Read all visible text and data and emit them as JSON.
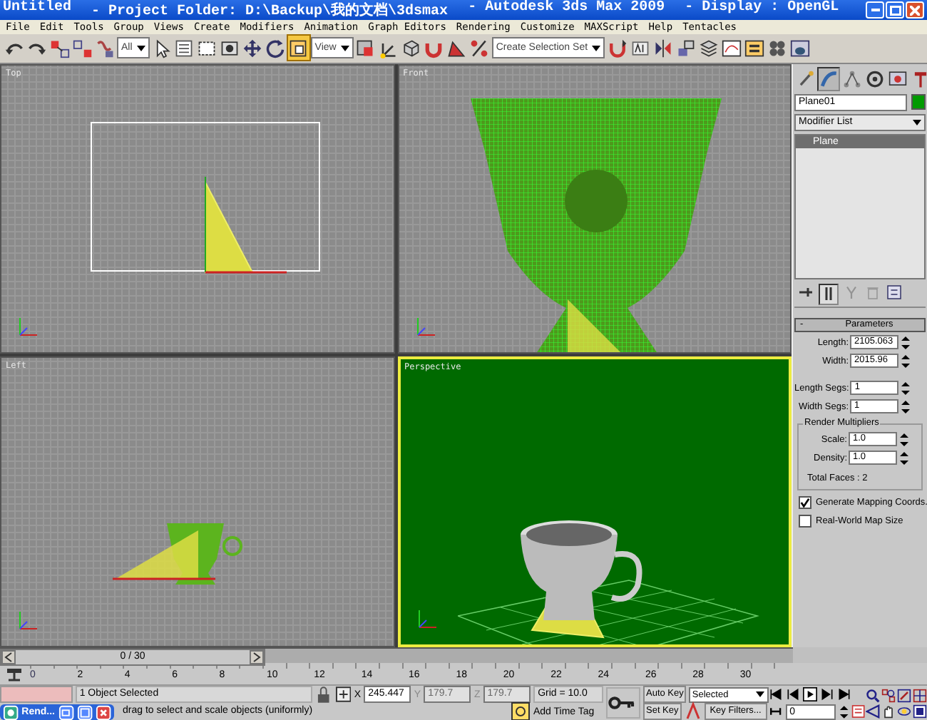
{
  "window": {
    "title_parts": [
      "Untitled",
      "- Project Folder: D:\\Backup\\我的文档\\3dsmax",
      "- Autodesk 3ds Max  2009",
      "- Display : OpenGL"
    ]
  },
  "menu": [
    "File",
    "Edit",
    "Tools",
    "Group",
    "Views",
    "Create",
    "Modifiers",
    "Animation",
    "Graph Editors",
    "Rendering",
    "Customize",
    "MAXScript",
    "Help",
    "Tentacles"
  ],
  "toolbar": [
    {
      "kind": "button",
      "selected": false
    },
    {
      "kind": "button",
      "selected": false
    },
    {
      "kind": "button",
      "selected": false
    },
    {
      "kind": "button",
      "selected": false
    },
    {
      "kind": "button",
      "selected": false
    },
    {
      "kind": "dropdown",
      "value": "All"
    },
    {
      "kind": "button",
      "selected": false
    },
    {
      "kind": "button",
      "selected": false
    },
    {
      "kind": "button",
      "selected": false
    },
    {
      "kind": "button",
      "selected": false
    },
    {
      "kind": "button",
      "selected": false
    },
    {
      "kind": "button",
      "selected": false
    },
    {
      "kind": "button",
      "selected": true
    },
    {
      "kind": "dropdown",
      "value": "View"
    },
    {
      "kind": "button",
      "selected": false
    },
    {
      "kind": "button",
      "selected": false
    },
    {
      "kind": "button",
      "selected": false
    },
    {
      "kind": "button",
      "selected": false
    },
    {
      "kind": "button",
      "selected": false
    },
    {
      "kind": "button",
      "selected": false
    },
    {
      "kind": "dropdown",
      "value": "Create Selection Set"
    },
    {
      "kind": "button",
      "selected": false
    },
    {
      "kind": "button",
      "selected": false
    },
    {
      "kind": "button",
      "selected": false
    },
    {
      "kind": "button",
      "selected": false
    },
    {
      "kind": "button",
      "selected": false
    },
    {
      "kind": "button",
      "selected": false
    },
    {
      "kind": "button",
      "selected": false
    },
    {
      "kind": "button",
      "selected": false
    },
    {
      "kind": "button",
      "selected": false
    }
  ],
  "viewports": [
    {
      "label": "Top",
      "kind": "top",
      "active": false
    },
    {
      "label": "Front",
      "kind": "front",
      "active": false
    },
    {
      "label": "Left",
      "kind": "left",
      "active": false
    },
    {
      "label": "Perspective",
      "kind": "perspective",
      "active": true
    }
  ],
  "command_panel": {
    "tabs": [
      {
        "selected": false
      },
      {
        "selected": true
      },
      {
        "selected": false
      },
      {
        "selected": false
      },
      {
        "selected": false
      },
      {
        "selected": false
      }
    ],
    "object_name": "Plane01",
    "modifier_list": "Modifier List",
    "stack": [
      {
        "label": "Plane",
        "selected": true
      }
    ],
    "stack_buttons": [
      {
        "disabled": false,
        "selected": false
      },
      {
        "disabled": false,
        "selected": true
      },
      {
        "disabled": true,
        "selected": false
      },
      {
        "disabled": true,
        "selected": false
      },
      {
        "disabled": false,
        "selected": false
      }
    ],
    "rollout": {
      "expander": "-",
      "title": "Parameters",
      "fields": [
        {
          "label": "Length:",
          "value": "2105.063"
        },
        {
          "label": "Width:",
          "value": "2015.96"
        },
        {
          "label": "Length Segs:",
          "value": "1"
        },
        {
          "label": "Width Segs:",
          "value": "1"
        }
      ],
      "group": {
        "title": "Render Multipliers",
        "fields": [
          {
            "label": "Scale:",
            "value": "1.0"
          },
          {
            "label": "Density:",
            "value": "1.0"
          }
        ],
        "note": "Total Faces : 2"
      },
      "checkboxes": [
        {
          "label": "Generate Mapping Coords.",
          "checked": true
        },
        {
          "label": "Real-World Map Size",
          "checked": false
        }
      ]
    }
  },
  "time_slider": {
    "label": "0 / 30",
    "level": 0
  },
  "ruler": [
    "0",
    "2",
    "4",
    "6",
    "8",
    "10",
    "12",
    "14",
    "16",
    "18",
    "20",
    "22",
    "24",
    "26",
    "28",
    "30"
  ],
  "status_bar": {
    "selection": "1 Object Selected",
    "prompt": "drag to select and scale objects (uniformly)",
    "coords": [
      {
        "axis": "X",
        "value": "245.447",
        "disabled": false
      },
      {
        "axis": "Y",
        "value": "179.7",
        "disabled": true
      },
      {
        "axis": "Z",
        "value": "179.7",
        "disabled": true
      }
    ],
    "grid": "Grid = 10.0",
    "time_tag": "Add Time Tag",
    "auto_key": "Auto Key",
    "set_key": "Set Key",
    "key_mode": "Selected",
    "key_filters": "Key Filters...",
    "frame": "0"
  },
  "taskbar_window": {
    "title": "Rend..."
  }
}
